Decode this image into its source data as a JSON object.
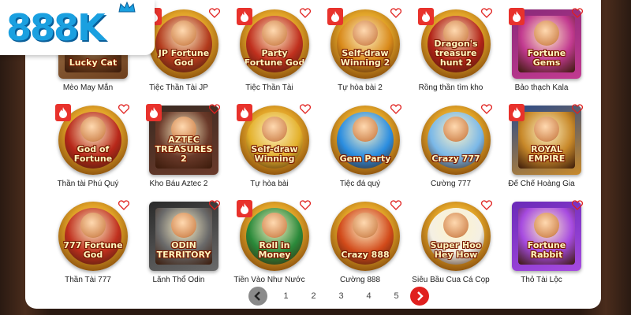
{
  "brand": {
    "logo_text": "888K"
  },
  "games": [
    {
      "name": "Mèo May Mắn",
      "logo": "Lucky Cat",
      "hot": false,
      "shape": "square",
      "bg": "#a67c52",
      "inner": "#6d3f1d"
    },
    {
      "name": "Tiệc Thần Tài JP",
      "logo": "JP Fortune God",
      "hot": true,
      "shape": "round",
      "bg": "#e0a227",
      "inner": "#b23a1c"
    },
    {
      "name": "Tiệc Thần Tài",
      "logo": "Party Fortune God",
      "hot": true,
      "shape": "round",
      "bg": "#e0a227",
      "inner": "#c0301e"
    },
    {
      "name": "Tự hòa bài 2",
      "logo": "Self-draw Winning 2",
      "hot": true,
      "shape": "round",
      "bg": "#e0a227",
      "inner": "#d98a1a"
    },
    {
      "name": "Rồng thần tìm kho",
      "logo": "Dragon's treasure hunt 2",
      "hot": true,
      "shape": "round",
      "bg": "#e0a227",
      "inner": "#b22318"
    },
    {
      "name": "Bảo thạch Kala",
      "logo": "Fortune Gems",
      "hot": true,
      "shape": "square",
      "bg": "#8a2a7a",
      "inner": "#c23a90"
    },
    {
      "name": "Thần tài Phú Quý",
      "logo": "God of Fortune",
      "hot": true,
      "shape": "round",
      "bg": "#e0a227",
      "inner": "#b8281a"
    },
    {
      "name": "Kho Báu Aztec 2",
      "logo": "AZTEC TREASURES 2",
      "hot": true,
      "shape": "square",
      "bg": "#3a2a22",
      "inner": "#6a3a2a"
    },
    {
      "name": "Tự hòa bài",
      "logo": "Self-draw Winning",
      "hot": true,
      "shape": "round",
      "bg": "#e0a227",
      "inner": "#e3b02a"
    },
    {
      "name": "Tiệc đá quý",
      "logo": "Gem Party",
      "hot": false,
      "shape": "round",
      "bg": "#e0a227",
      "inner": "#2a8de0"
    },
    {
      "name": "Cường 777",
      "logo": "Crazy 777",
      "hot": false,
      "shape": "round",
      "bg": "#e0a227",
      "inner": "#7ab8e8"
    },
    {
      "name": "Đế Chế Hoàng Gia",
      "logo": "ROYAL EMPIRE",
      "hot": true,
      "shape": "square",
      "bg": "#2a4a8a",
      "inner": "#c8892a"
    },
    {
      "name": "Thần Tài 777",
      "logo": "777 Fortune God",
      "hot": false,
      "shape": "round",
      "bg": "#e0a227",
      "inner": "#c0301e"
    },
    {
      "name": "Lãnh Thổ Odin",
      "logo": "ODIN TERRITORY",
      "hot": false,
      "shape": "square",
      "bg": "#2a2a2a",
      "inner": "#6a6a6a"
    },
    {
      "name": "Tiền Vào Như Nước",
      "logo": "Roll in Money",
      "hot": true,
      "shape": "round",
      "bg": "#e0a227",
      "inner": "#2a8a3a"
    },
    {
      "name": "Cường 888",
      "logo": "Crazy 888",
      "hot": false,
      "shape": "round",
      "bg": "#e0a227",
      "inner": "#d24a1a"
    },
    {
      "name": "Siêu Bầu Cua Cá Cọp",
      "logo": "Super Hoo Hey How",
      "hot": false,
      "shape": "round",
      "bg": "#e0a227",
      "inner": "#f4f0e4"
    },
    {
      "name": "Thỏ Tài Lộc",
      "logo": "Fortune Rabbit",
      "hot": false,
      "shape": "square",
      "bg": "#6a2ab8",
      "inner": "#a64ae0"
    }
  ],
  "pagination": {
    "pages": [
      "1",
      "2",
      "3",
      "4",
      "5"
    ],
    "prev_icon": "chevron-left-icon",
    "next_icon": "chevron-right-icon"
  },
  "colors": {
    "hot_badge": "#e8322c",
    "next_button": "#e0201e",
    "prev_button": "#8a8a8a",
    "brand": "#1aa0e0"
  }
}
